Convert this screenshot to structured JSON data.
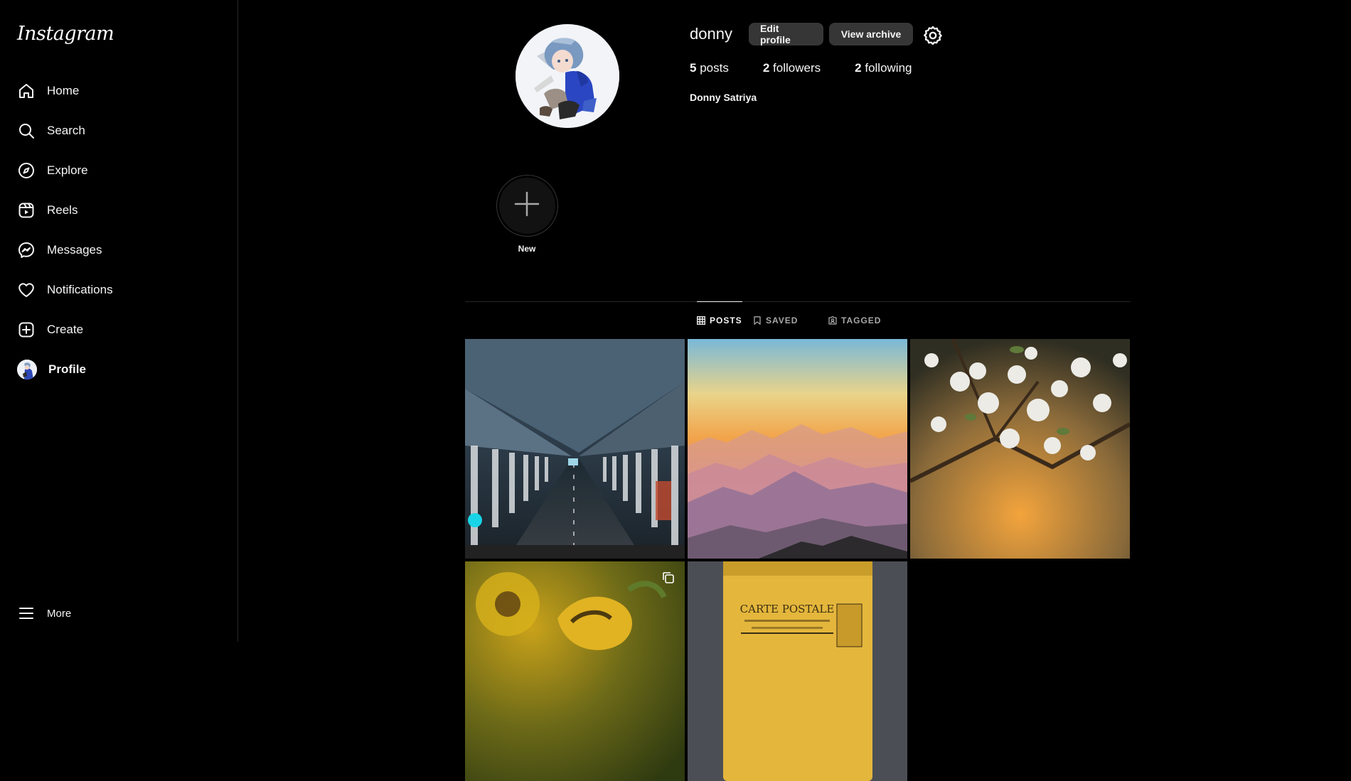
{
  "app": {
    "logo_text": "Instagram"
  },
  "sidebar": {
    "items": [
      {
        "label": "Home",
        "icon": "home-icon"
      },
      {
        "label": "Search",
        "icon": "search-icon"
      },
      {
        "label": "Explore",
        "icon": "compass-icon"
      },
      {
        "label": "Reels",
        "icon": "reels-icon"
      },
      {
        "label": "Messages",
        "icon": "messenger-icon"
      },
      {
        "label": "Notifications",
        "icon": "heart-icon"
      },
      {
        "label": "Create",
        "icon": "plus-square-icon"
      },
      {
        "label": "Profile",
        "icon": "avatar",
        "active": true
      }
    ],
    "more_label": "More"
  },
  "profile": {
    "username": "donny",
    "edit_label": "Edit profile",
    "archive_label": "View archive",
    "posts_count": "5",
    "posts_label": "posts",
    "followers_count": "2",
    "followers_label": "followers",
    "following_count": "2",
    "following_label": "following",
    "full_name": "Donny Satriya"
  },
  "highlights": {
    "new_label": "New"
  },
  "tabs": [
    {
      "label": "POSTS",
      "icon": "grid-icon",
      "active": true
    },
    {
      "label": "SAVED",
      "icon": "bookmark-icon"
    },
    {
      "label": "TAGGED",
      "icon": "tag-user-icon"
    }
  ],
  "posts": [
    {
      "subject": "underpass-road",
      "multi": false
    },
    {
      "subject": "mountain-sunset",
      "multi": false
    },
    {
      "subject": "white-blossoms",
      "multi": false
    },
    {
      "subject": "sunflower",
      "multi": true
    },
    {
      "subject": "carte-postale-mailbox",
      "multi": false,
      "caption_text": "CARTE POSTALE"
    }
  ],
  "colors": {
    "background": "#000000",
    "button": "#363636",
    "text": "#f5f5f5",
    "muted": "#a8a8a8",
    "divider": "#262626"
  }
}
